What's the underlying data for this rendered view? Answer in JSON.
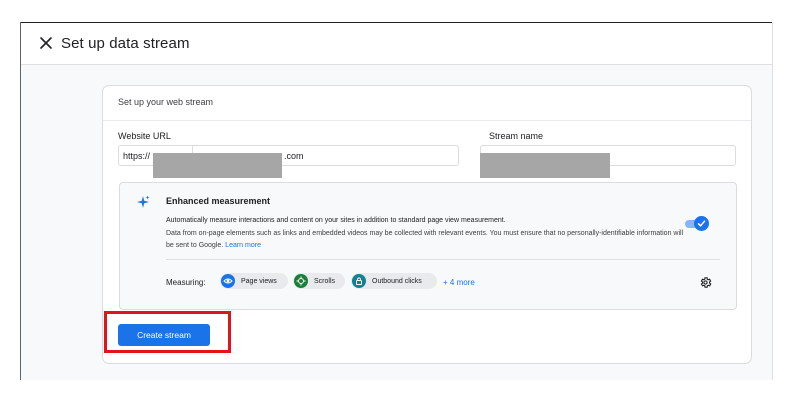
{
  "header": {
    "title": "Set up data stream",
    "close_icon": "close-icon"
  },
  "card": {
    "title": "Set up your web stream",
    "website_url": {
      "label": "Website URL",
      "prefix": "https://",
      "suffix": ".com"
    },
    "stream_name": {
      "label": "Stream name"
    }
  },
  "enhanced": {
    "title": "Enhanced measurement",
    "description_bold": "Automatically measure interactions and content on your sites in addition to standard page view measurement.",
    "description_detail": "Data from on-page elements such as links and embedded videos may be collected with relevant events. You must ensure that no personally-identifiable information will be sent to Google.",
    "learn_more": "Learn more",
    "toggle_on": true,
    "measuring_label": "Measuring:",
    "chips": [
      {
        "label": "Page views",
        "icon": "eye-icon",
        "color": "#1a73e8"
      },
      {
        "label": "Scrolls",
        "icon": "crosshair-icon",
        "color": "#188038"
      },
      {
        "label": "Outbound clicks",
        "icon": "lock-icon",
        "color": "#12828e"
      }
    ],
    "more": "+ 4 more"
  },
  "actions": {
    "create_label": "Create stream"
  },
  "colors": {
    "primary": "#1a73e8",
    "highlight": "#e1141c",
    "redaction": "#a6a6a6"
  }
}
